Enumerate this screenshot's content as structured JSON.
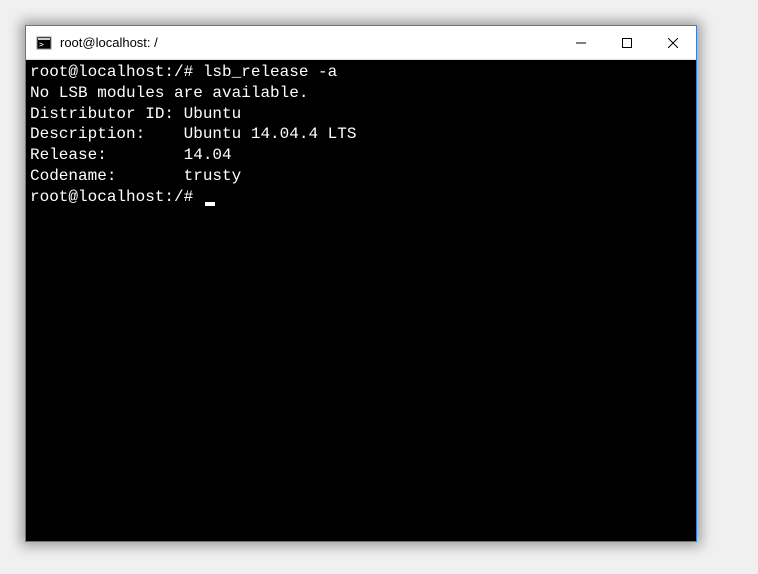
{
  "window": {
    "title": "root@localhost: /"
  },
  "terminal": {
    "lines": [
      "root@localhost:/# lsb_release -a",
      "No LSB modules are available.",
      "Distributor ID: Ubuntu",
      "Description:    Ubuntu 14.04.4 LTS",
      "Release:        14.04",
      "Codename:       trusty"
    ],
    "prompt": "root@localhost:/# "
  }
}
